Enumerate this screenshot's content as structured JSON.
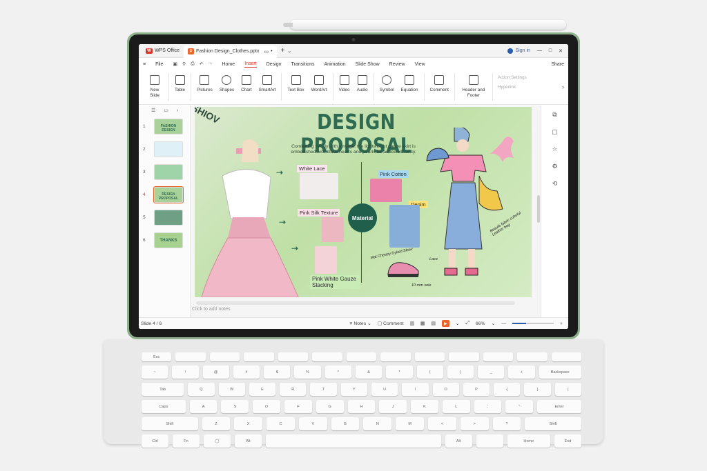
{
  "titlebar": {
    "app_tab": "WPS Office",
    "doc_tab": "Fashion Design_Clothes.pptx",
    "sign_in": "Sign in"
  },
  "menu": {
    "file": "File",
    "items": [
      "Home",
      "Insert",
      "Design",
      "Transitions",
      "Animation",
      "Slide Show",
      "Review",
      "View"
    ],
    "active": "Insert",
    "share": "Share"
  },
  "ribbon": {
    "new_slide": "New Slide",
    "table": "Table",
    "pictures": "Pictures",
    "shapes": "Shapes",
    "chart": "Chart",
    "smartart": "SmartArt",
    "text_box": "Text Box",
    "wordart": "WordArt",
    "video": "Video",
    "audio": "Audio",
    "symbol": "Symbol",
    "equation": "Equation",
    "comment": "Comment",
    "header_footer": "Header and Footer",
    "action_settings": "Action Settings",
    "hyperlink": "Hyperlink"
  },
  "thumbnails": [
    {
      "num": "1",
      "text": "FASHION DESIGN"
    },
    {
      "num": "2",
      "text": ""
    },
    {
      "num": "3",
      "text": ""
    },
    {
      "num": "4",
      "text": "DESIGN PROPOSAL"
    },
    {
      "num": "5",
      "text": ""
    },
    {
      "num": "6",
      "text": "THANKS"
    }
  ],
  "slide": {
    "title": "DESIGN PROPOSAL",
    "subtitle": "Combining trendy with vintage, the lightweight gauze skirt is embellished with black hearts and pearls for added vibrancy.",
    "corner": "SHIOV",
    "material": "Material",
    "white_lace": "White Lace",
    "pink_silk": "Pink Silk Texture",
    "pink_gauze": "Pink White Gauze Stacking",
    "pink_cotton": "Pink Cotton",
    "denim": "Denim",
    "note_shoes": "Mat Cheetry Dyked Sleev",
    "note_lace": "Lace",
    "note_bag": "Beauté fabric colorful Leather bag",
    "note_sole": "10 mm sole"
  },
  "notes_placeholder": "Click to add notes",
  "status": {
    "slide_indicator": "Slide 4 / 6",
    "notes": "Notes",
    "comment": "Comment",
    "zoom": "66%"
  },
  "colors": {
    "accent": "#d9362a",
    "ppt_orange": "#e8652c",
    "title_green": "#2f6b52",
    "tablet_frame": "#8fb08c"
  },
  "keyboard": {
    "row0": [
      "Esc",
      "",
      "",
      "",
      "",
      "",
      "",
      "",
      "",
      "",
      "",
      "",
      ""
    ],
    "row1": [
      "~",
      "!",
      "@",
      "#",
      "$",
      "%",
      "^",
      "&",
      "*",
      "(",
      ")",
      "_",
      "+",
      "Backspace"
    ],
    "row2": [
      "Tab",
      "Q",
      "W",
      "E",
      "R",
      "T",
      "Y",
      "U",
      "I",
      "O",
      "P",
      "{",
      "}",
      "|"
    ],
    "row3": [
      "Caps",
      "A",
      "S",
      "D",
      "F",
      "G",
      "H",
      "J",
      "K",
      "L",
      ":",
      "\"",
      "Enter"
    ],
    "row4": [
      "Shift",
      "Z",
      "X",
      "C",
      "V",
      "B",
      "N",
      "M",
      "<",
      ">",
      "?",
      "Shift"
    ],
    "row5": [
      "Ctrl",
      "Fn",
      "",
      "Alt",
      "",
      "Alt",
      "",
      "Home",
      "End"
    ]
  }
}
